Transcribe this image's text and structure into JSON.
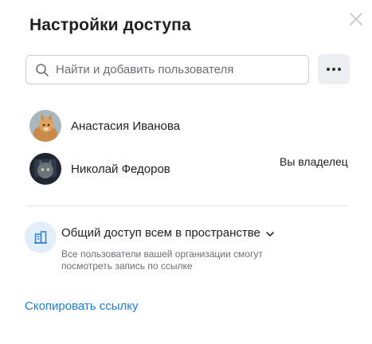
{
  "dialog": {
    "title": "Настройки доступа",
    "close_icon": "close-icon"
  },
  "search": {
    "placeholder": "Найти и добавить пользователя",
    "value": "",
    "icon": "search-icon"
  },
  "more_button": {
    "icon": "more-horizontal-icon"
  },
  "users": [
    {
      "name": "Анастасия Иванова",
      "role": "",
      "avatar": "avatar-orange-cat"
    },
    {
      "name": "Николай Федоров",
      "role": "Вы владелец",
      "avatar": "avatar-gray-cat"
    }
  ],
  "access": {
    "icon": "building-icon",
    "title": "Общий доступ всем в пространстве",
    "description": "Все пользователи вашей организации смогут посмотреть запись по ссылке",
    "chevron_icon": "chevron-down-icon"
  },
  "copy_link_label": "Скопировать ссылку",
  "colors": {
    "accent": "#1a7fd8",
    "icon_bg": "#e3eefb",
    "button_bg": "#eceef1"
  }
}
